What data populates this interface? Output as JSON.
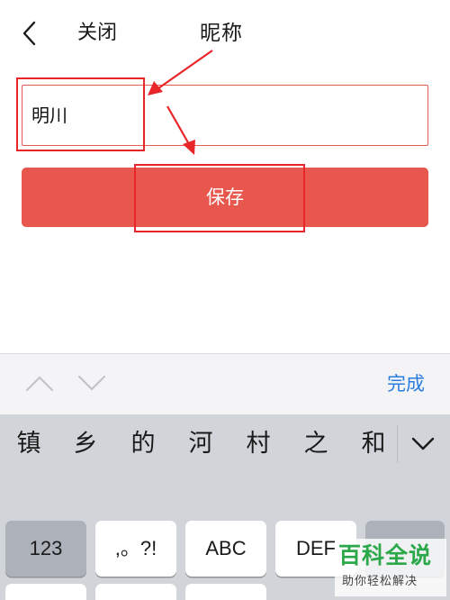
{
  "nav": {
    "back_icon": "chevron-left-icon",
    "close_label": "关闭",
    "title": "昵称"
  },
  "form": {
    "nickname_value": "明川",
    "save_label": "保存"
  },
  "accessory_bar": {
    "prev_icon": "chevron-up-icon",
    "next_icon": "chevron-down-icon",
    "done_label": "完成"
  },
  "keyboard": {
    "candidates": [
      "镇",
      "乡",
      "的",
      "河",
      "村",
      "之",
      "和"
    ],
    "expand_icon": "chevron-down-icon",
    "keys": [
      "123",
      ",。?!",
      "ABC",
      "DEF"
    ]
  },
  "watermark": {
    "title": "百科全说",
    "subtitle": "助你轻松解决"
  },
  "colors": {
    "accent_red": "#e8574e",
    "annotation_red": "#e8262a",
    "done_blue": "#2a7de1",
    "watermark_green": "#2aa84a"
  }
}
